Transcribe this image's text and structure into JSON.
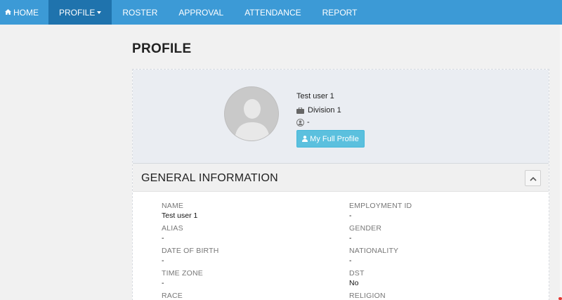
{
  "nav": {
    "home": "HOME",
    "profile": "PROFILE",
    "roster": "ROSTER",
    "approval": "APPROVAL",
    "attendance": "ATTENDANCE",
    "report": "REPORT",
    "active": "PROFILE"
  },
  "page": {
    "title": "PROFILE"
  },
  "user": {
    "name": "Test user 1",
    "division": "Division 1",
    "extra": "-",
    "full_profile_button": "My Full Profile"
  },
  "general": {
    "title": "GENERAL INFORMATION",
    "fields": [
      {
        "label": "NAME",
        "value": "Test user 1"
      },
      {
        "label": "EMPLOYMENT ID",
        "value": "-"
      },
      {
        "label": "ALIAS",
        "value": "-"
      },
      {
        "label": "GENDER",
        "value": "-"
      },
      {
        "label": "DATE OF BIRTH",
        "value": "-"
      },
      {
        "label": "NATIONALITY",
        "value": "-"
      },
      {
        "label": "TIME ZONE",
        "value": "-"
      },
      {
        "label": "DST",
        "value": "No"
      },
      {
        "label": "RACE",
        "value": ""
      },
      {
        "label": "RELIGION",
        "value": ""
      }
    ]
  },
  "colors": {
    "navbar": "#3c9ad6",
    "navbar_active": "#1f73ad",
    "button_info": "#5bc0de",
    "card_header": "#eaedf2"
  },
  "icons": [
    "home-icon",
    "briefcase-icon",
    "user-circle-icon",
    "user-icon",
    "chevron-up-icon"
  ]
}
